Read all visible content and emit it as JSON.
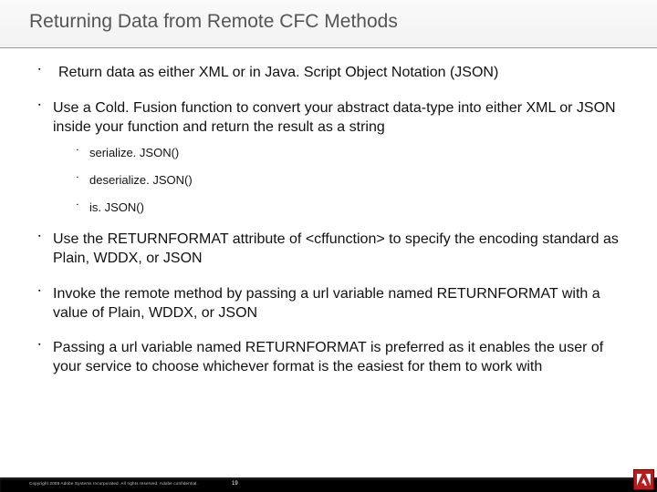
{
  "title": "Returning Data from Remote CFC Methods",
  "bullets": {
    "b0": "Return data as either XML or in Java. Script Object Notation (JSON)",
    "b1": "Use a Cold. Fusion function to convert your abstract data-type into either XML or JSON inside your function and return the result as a string",
    "b1s0": "serialize. JSON()",
    "b1s1": "deserialize. JSON()",
    "b1s2": "is. JSON()",
    "b2": "Use the RETURNFORMAT attribute of <cffunction> to specify the encoding standard as Plain, WDDX, or JSON",
    "b3": "Invoke the remote method by passing a url variable named RETURNFORMAT with a value of Plain, WDDX, or JSON",
    "b4": "Passing a url variable named RETURNFORMAT is preferred as it enables the user of your service to choose whichever format is the easiest for them to work with"
  },
  "footer": {
    "copyright": "Copyright 2009 Adobe Systems Incorporated.  All rights reserved.  Adobe confidential.",
    "page": "19"
  }
}
